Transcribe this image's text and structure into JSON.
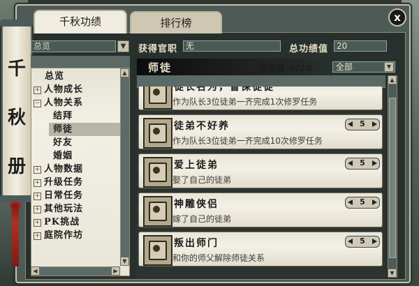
{
  "window": {
    "close_label": "x"
  },
  "scroll": {
    "chars": [
      "千",
      "秋",
      "册"
    ]
  },
  "tabs": [
    {
      "label": "千秋功绩",
      "active": true
    },
    {
      "label": "排行榜",
      "active": false
    }
  ],
  "left": {
    "overview_value": "总览",
    "tree": [
      {
        "label": "总览",
        "kind": "leaf"
      },
      {
        "label": "人物成长",
        "kind": "collapsed"
      },
      {
        "label": "人物关系",
        "kind": "expanded"
      },
      {
        "label": "结拜",
        "kind": "child"
      },
      {
        "label": "师徒",
        "kind": "child-selected"
      },
      {
        "label": "好友",
        "kind": "child"
      },
      {
        "label": "婚姻",
        "kind": "child"
      },
      {
        "label": "人物数据",
        "kind": "collapsed"
      },
      {
        "label": "升级任务",
        "kind": "collapsed"
      },
      {
        "label": "日常任务",
        "kind": "collapsed"
      },
      {
        "label": "其他玩法",
        "kind": "collapsed"
      },
      {
        "label": "PK挑战",
        "kind": "collapsed"
      },
      {
        "label": "庭院作坊",
        "kind": "collapsed"
      }
    ]
  },
  "header": {
    "title_label": "获得官职",
    "title_value": "无",
    "total_label": "总功绩值",
    "total_value": "20",
    "category": "师徒",
    "progress_label": "完成度:0/20",
    "filter_value": "全部"
  },
  "achievements": [
    {
      "title": "徒长名为，督保徒徒",
      "desc": "作为队长3位徒弟一齐完成1次修罗任务",
      "points": "5"
    },
    {
      "title": "徒弟不好养",
      "desc": "作为队长3位徒弟一齐完成10次修罗任务",
      "points": "5"
    },
    {
      "title": "爱上徒弟",
      "desc": "娶了自己的徒弟",
      "points": "5"
    },
    {
      "title": "神雕侠侣",
      "desc": "嫁了自己的徒弟",
      "points": "5"
    },
    {
      "title": "叛出师门",
      "desc": "和你的师父解除师徒关系",
      "points": "5"
    }
  ],
  "icons": [
    "close-icon",
    "dropdown-arrow-icon",
    "scroll-up-icon",
    "scroll-down-icon",
    "scroll-left-icon",
    "scroll-right-icon",
    "achievement-icon"
  ]
}
